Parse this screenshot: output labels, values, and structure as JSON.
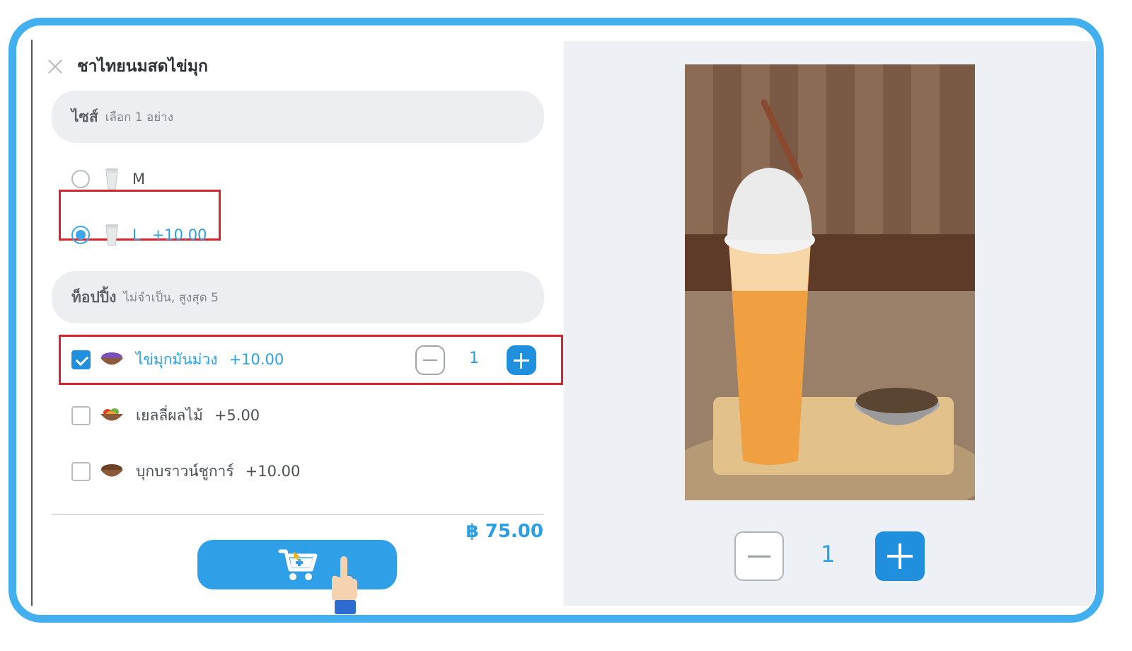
{
  "product": {
    "title": "ชาไทยนมสดไข่มุก",
    "image": "thai-iced-tea-photo"
  },
  "size_section": {
    "title": "ไซส์",
    "subtitle": "เลือก 1 อย่าง",
    "options": [
      {
        "label": "M",
        "price": "",
        "selected": false
      },
      {
        "label": "L",
        "price": "+10.00",
        "selected": true
      }
    ]
  },
  "topping_section": {
    "title": "ท็อปปิ้ง",
    "subtitle": "ไม่จำเป็น, สูงสุด 5",
    "options": [
      {
        "label": "ไข่มุกมันม่วง",
        "price": "+10.00",
        "checked": true,
        "quantity": "1"
      },
      {
        "label": "เยลลี่ผลไม้",
        "price": "+5.00",
        "checked": false
      },
      {
        "label": "บุกบราวน์ชูการ์",
        "price": "+10.00",
        "checked": false
      }
    ]
  },
  "total": "฿ 75.00",
  "quantity": "1",
  "colors": {
    "accent": "#2a9fe4",
    "button": "#1f8fde",
    "frame": "#42b0ef",
    "highlight_box": "#d8242c"
  },
  "icons": [
    "close-icon",
    "cup-icon",
    "bowl-icon",
    "cart-icon",
    "hand-pointer-icon",
    "minus-icon",
    "plus-icon"
  ]
}
